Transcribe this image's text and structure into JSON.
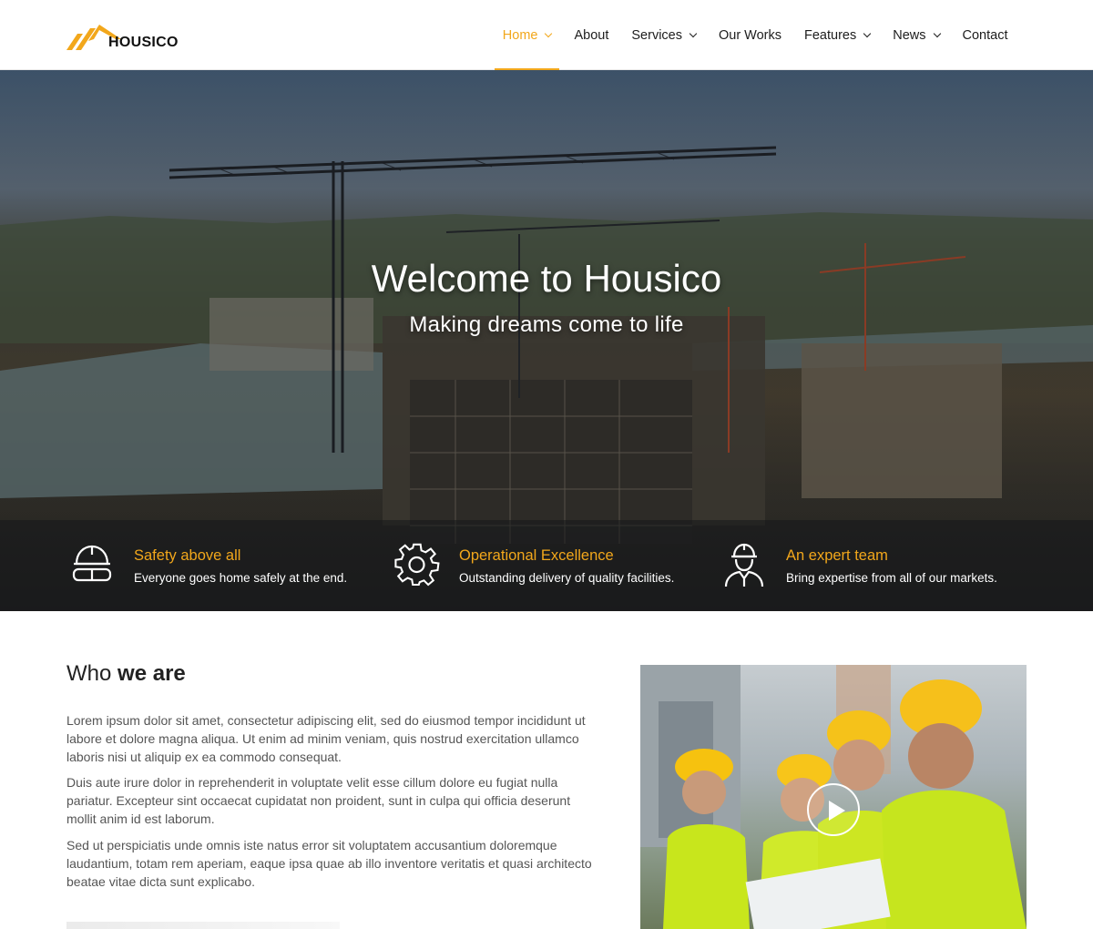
{
  "brand": {
    "name": "HOUSICO",
    "accent": "#f2a71b"
  },
  "nav": {
    "items": [
      {
        "label": "Home",
        "dropdown": true,
        "active": true
      },
      {
        "label": "About",
        "dropdown": false
      },
      {
        "label": "Services",
        "dropdown": true
      },
      {
        "label": "Our Works",
        "dropdown": false
      },
      {
        "label": "Features",
        "dropdown": true
      },
      {
        "label": "News",
        "dropdown": true
      },
      {
        "label": "Contact",
        "dropdown": false
      }
    ]
  },
  "hero": {
    "title": "Welcome to Housico",
    "subtitle": "Making dreams come to life",
    "features": [
      {
        "icon": "safety-helmet-goggles-icon",
        "title": "Safety above all",
        "text": "Everyone goes home safely at the end."
      },
      {
        "icon": "gear-icon",
        "title": "Operational Excellence",
        "text": "Outstanding delivery of quality facilities."
      },
      {
        "icon": "worker-icon",
        "title": "An expert team",
        "text": "Bring expertise from all of our markets."
      }
    ]
  },
  "about": {
    "title_light": "Who",
    "title_bold": "we are",
    "paragraphs": [
      "Lorem ipsum dolor sit amet, consectetur adipiscing elit, sed do eiusmod tempor incididunt ut labore et dolore magna aliqua. Ut enim ad minim veniam, quis nostrud exercitation ullamco laboris nisi ut aliquip ex ea commodo consequat.",
      "Duis aute irure dolor in reprehenderit in voluptate velit esse cillum dolore eu fugiat nulla pariatur. Excepteur sint occaecat cupidatat non proident, sunt in culpa qui officia deserunt mollit anim id est laborum.",
      "Sed ut perspiciatis unde omnis iste natus error sit voluptatem accusantium doloremque laudantium, totam rem aperiam, eaque ipsa quae ab illo inventore veritatis et quasi architecto beatae vitae dicta sunt explicabo."
    ],
    "video": {
      "icon": "play-icon"
    }
  }
}
